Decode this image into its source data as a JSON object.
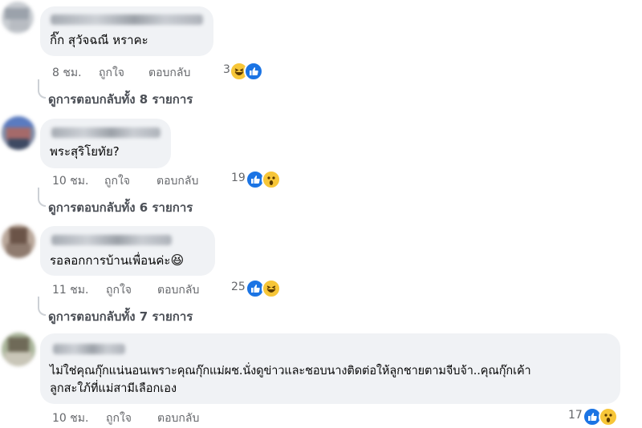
{
  "comments": [
    {
      "text": "กิ๊ก สุวัจฉณี หราคะ",
      "time": "8 ชม.",
      "like": "ถูกใจ",
      "reply": "ตอบกลับ",
      "reaction_count": "3",
      "reactions": [
        "haha",
        "like"
      ],
      "view_replies": "ดูการตอบกลับทั้ง 8 รายการ"
    },
    {
      "text": "พระสุริโยทัย?",
      "time": "10 ชม.",
      "like": "ถูกใจ",
      "reply": "ตอบกลับ",
      "reaction_count": "19",
      "reactions": [
        "like",
        "wow"
      ],
      "view_replies": "ดูการตอบกลับทั้ง 6 รายการ"
    },
    {
      "text": "รอลอกการบ้านเพื่อนค่ะ",
      "text_emoji": "😆",
      "time": "11 ชม.",
      "like": "ถูกใจ",
      "reply": "ตอบกลับ",
      "reaction_count": "25",
      "reactions": [
        "like",
        "haha"
      ],
      "view_replies": "ดูการตอบกลับทั้ง 7 รายการ"
    },
    {
      "text_line1": "ไม่ใช่คุณกุ๊กแน่นอนเพราะคุณกุ๊กแม่ผช.นั่งดูข่าวและชอบนางติดต่อให้ลูกชายตามจีบจ้า..คุณกุ๊กเค้า",
      "text_line2": "ลูกสะใภ้ที่แม่สามีเลือกเอง",
      "time": "10 ชม.",
      "like": "ถูกใจ",
      "reply": "ตอบกลับ",
      "reaction_count": "17",
      "reactions": [
        "like",
        "wow"
      ]
    }
  ],
  "colors": {
    "bubble": "#f0f2f5",
    "meta_text": "#65676b",
    "like_blue": "#1b74e4",
    "emoji_yellow": "#f7c638"
  },
  "icons": [
    "haha-reaction-icon",
    "like-reaction-icon",
    "wow-reaction-icon"
  ]
}
